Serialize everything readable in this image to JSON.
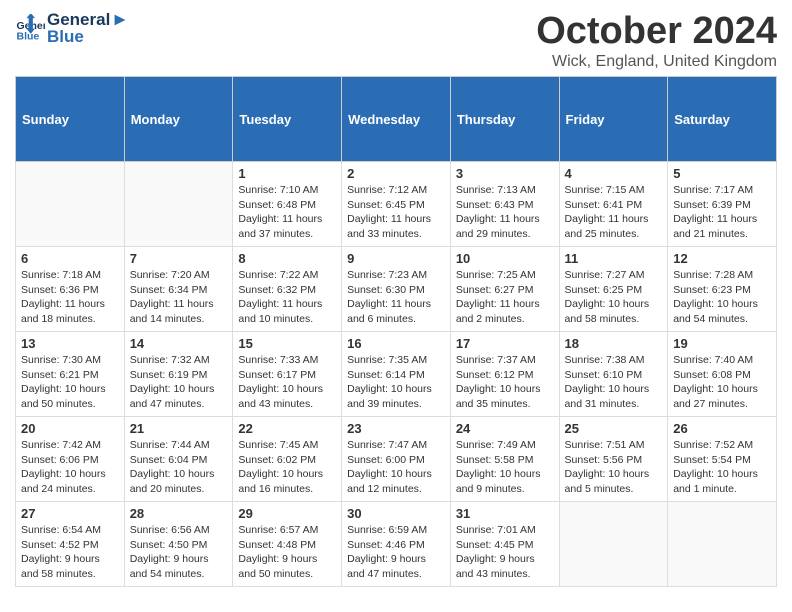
{
  "header": {
    "logo_line1": "General",
    "logo_line2": "Blue",
    "month": "October 2024",
    "location": "Wick, England, United Kingdom"
  },
  "days_of_week": [
    "Sunday",
    "Monday",
    "Tuesday",
    "Wednesday",
    "Thursday",
    "Friday",
    "Saturday"
  ],
  "weeks": [
    [
      {
        "day": "",
        "info": ""
      },
      {
        "day": "",
        "info": ""
      },
      {
        "day": "1",
        "info": "Sunrise: 7:10 AM\nSunset: 6:48 PM\nDaylight: 11 hours\nand 37 minutes."
      },
      {
        "day": "2",
        "info": "Sunrise: 7:12 AM\nSunset: 6:45 PM\nDaylight: 11 hours\nand 33 minutes."
      },
      {
        "day": "3",
        "info": "Sunrise: 7:13 AM\nSunset: 6:43 PM\nDaylight: 11 hours\nand 29 minutes."
      },
      {
        "day": "4",
        "info": "Sunrise: 7:15 AM\nSunset: 6:41 PM\nDaylight: 11 hours\nand 25 minutes."
      },
      {
        "day": "5",
        "info": "Sunrise: 7:17 AM\nSunset: 6:39 PM\nDaylight: 11 hours\nand 21 minutes."
      }
    ],
    [
      {
        "day": "6",
        "info": "Sunrise: 7:18 AM\nSunset: 6:36 PM\nDaylight: 11 hours\nand 18 minutes."
      },
      {
        "day": "7",
        "info": "Sunrise: 7:20 AM\nSunset: 6:34 PM\nDaylight: 11 hours\nand 14 minutes."
      },
      {
        "day": "8",
        "info": "Sunrise: 7:22 AM\nSunset: 6:32 PM\nDaylight: 11 hours\nand 10 minutes."
      },
      {
        "day": "9",
        "info": "Sunrise: 7:23 AM\nSunset: 6:30 PM\nDaylight: 11 hours\nand 6 minutes."
      },
      {
        "day": "10",
        "info": "Sunrise: 7:25 AM\nSunset: 6:27 PM\nDaylight: 11 hours\nand 2 minutes."
      },
      {
        "day": "11",
        "info": "Sunrise: 7:27 AM\nSunset: 6:25 PM\nDaylight: 10 hours\nand 58 minutes."
      },
      {
        "day": "12",
        "info": "Sunrise: 7:28 AM\nSunset: 6:23 PM\nDaylight: 10 hours\nand 54 minutes."
      }
    ],
    [
      {
        "day": "13",
        "info": "Sunrise: 7:30 AM\nSunset: 6:21 PM\nDaylight: 10 hours\nand 50 minutes."
      },
      {
        "day": "14",
        "info": "Sunrise: 7:32 AM\nSunset: 6:19 PM\nDaylight: 10 hours\nand 47 minutes."
      },
      {
        "day": "15",
        "info": "Sunrise: 7:33 AM\nSunset: 6:17 PM\nDaylight: 10 hours\nand 43 minutes."
      },
      {
        "day": "16",
        "info": "Sunrise: 7:35 AM\nSunset: 6:14 PM\nDaylight: 10 hours\nand 39 minutes."
      },
      {
        "day": "17",
        "info": "Sunrise: 7:37 AM\nSunset: 6:12 PM\nDaylight: 10 hours\nand 35 minutes."
      },
      {
        "day": "18",
        "info": "Sunrise: 7:38 AM\nSunset: 6:10 PM\nDaylight: 10 hours\nand 31 minutes."
      },
      {
        "day": "19",
        "info": "Sunrise: 7:40 AM\nSunset: 6:08 PM\nDaylight: 10 hours\nand 27 minutes."
      }
    ],
    [
      {
        "day": "20",
        "info": "Sunrise: 7:42 AM\nSunset: 6:06 PM\nDaylight: 10 hours\nand 24 minutes."
      },
      {
        "day": "21",
        "info": "Sunrise: 7:44 AM\nSunset: 6:04 PM\nDaylight: 10 hours\nand 20 minutes."
      },
      {
        "day": "22",
        "info": "Sunrise: 7:45 AM\nSunset: 6:02 PM\nDaylight: 10 hours\nand 16 minutes."
      },
      {
        "day": "23",
        "info": "Sunrise: 7:47 AM\nSunset: 6:00 PM\nDaylight: 10 hours\nand 12 minutes."
      },
      {
        "day": "24",
        "info": "Sunrise: 7:49 AM\nSunset: 5:58 PM\nDaylight: 10 hours\nand 9 minutes."
      },
      {
        "day": "25",
        "info": "Sunrise: 7:51 AM\nSunset: 5:56 PM\nDaylight: 10 hours\nand 5 minutes."
      },
      {
        "day": "26",
        "info": "Sunrise: 7:52 AM\nSunset: 5:54 PM\nDaylight: 10 hours\nand 1 minute."
      }
    ],
    [
      {
        "day": "27",
        "info": "Sunrise: 6:54 AM\nSunset: 4:52 PM\nDaylight: 9 hours\nand 58 minutes."
      },
      {
        "day": "28",
        "info": "Sunrise: 6:56 AM\nSunset: 4:50 PM\nDaylight: 9 hours\nand 54 minutes."
      },
      {
        "day": "29",
        "info": "Sunrise: 6:57 AM\nSunset: 4:48 PM\nDaylight: 9 hours\nand 50 minutes."
      },
      {
        "day": "30",
        "info": "Sunrise: 6:59 AM\nSunset: 4:46 PM\nDaylight: 9 hours\nand 47 minutes."
      },
      {
        "day": "31",
        "info": "Sunrise: 7:01 AM\nSunset: 4:45 PM\nDaylight: 9 hours\nand 43 minutes."
      },
      {
        "day": "",
        "info": ""
      },
      {
        "day": "",
        "info": ""
      }
    ]
  ]
}
